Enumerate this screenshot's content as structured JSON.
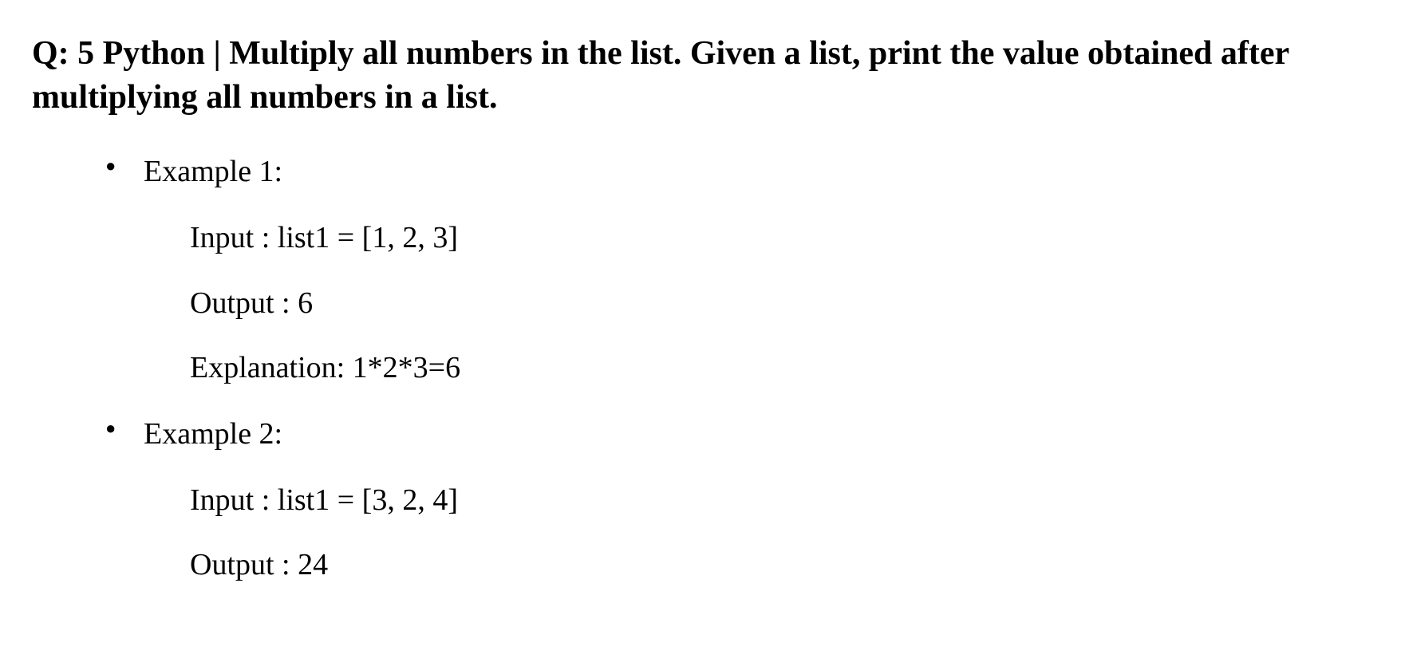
{
  "heading": "Q: 5 Python | Multiply all numbers in the list. Given a list, print the value obtained after multiplying all numbers in a list.",
  "examples": [
    {
      "label": "Example 1:",
      "lines": [
        "Input :  list1 = [1, 2, 3]",
        "Output : 6",
        "Explanation: 1*2*3=6"
      ]
    },
    {
      "label": "Example 2:",
      "lines": [
        "Input : list1 = [3, 2, 4]",
        "Output : 24"
      ]
    }
  ]
}
